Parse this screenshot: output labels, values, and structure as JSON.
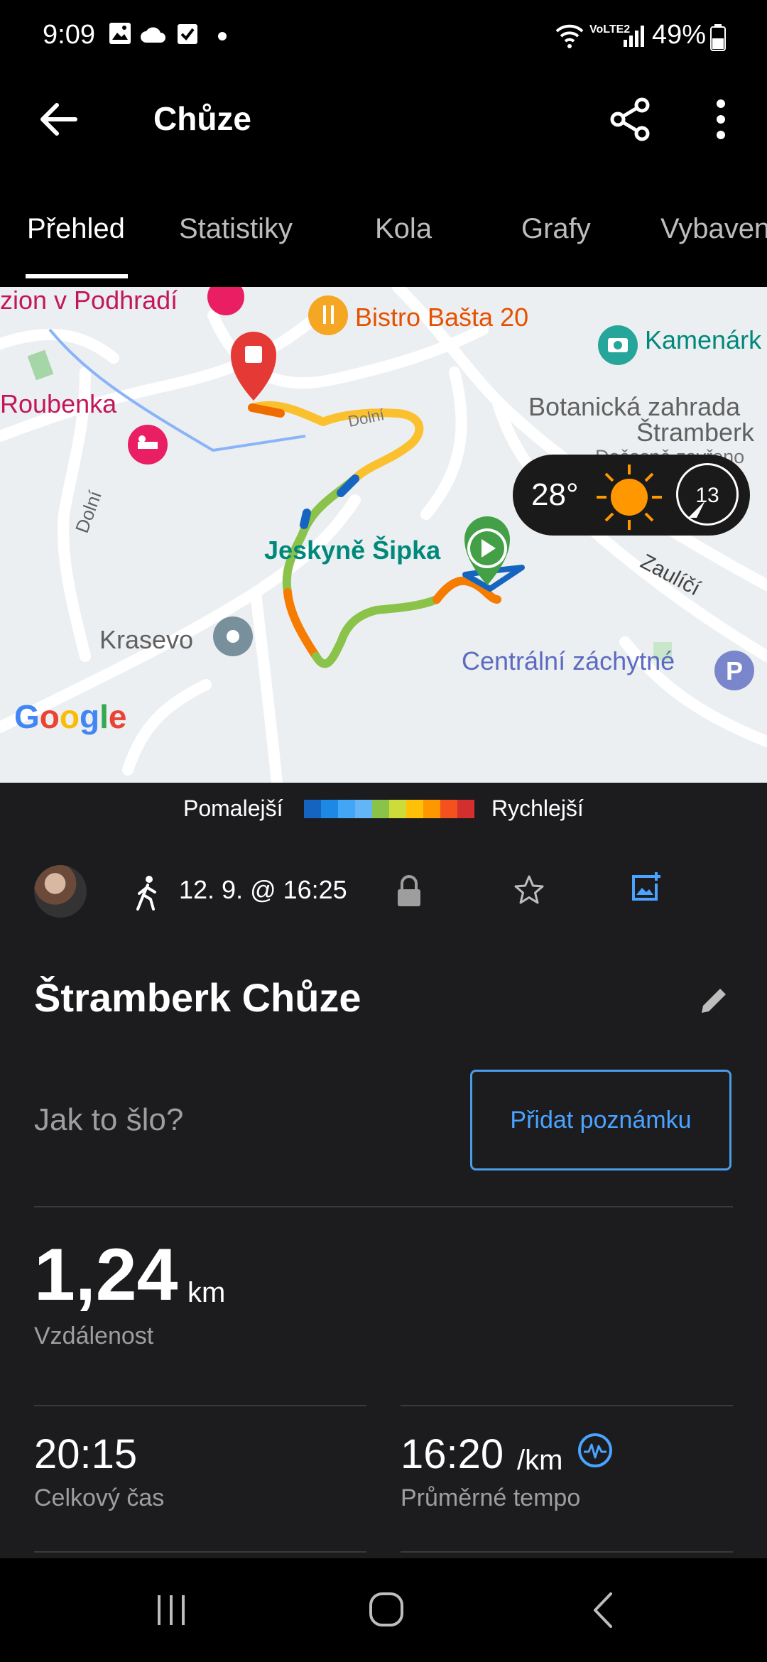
{
  "status_bar": {
    "time": "9:09",
    "battery": "49%",
    "network": "VoLTE2"
  },
  "app_bar": {
    "title": "Chůze",
    "back_icon": "arrow-left-icon",
    "share_icon": "share-icon",
    "more_icon": "more-vert-icon"
  },
  "tabs": [
    {
      "label": "Přehled",
      "active": true
    },
    {
      "label": "Statistiky",
      "active": false
    },
    {
      "label": "Kola",
      "active": false
    },
    {
      "label": "Grafy",
      "active": false
    },
    {
      "label": "Vybaven",
      "active": false
    }
  ],
  "map": {
    "labels": {
      "penzion": "zion v Podhradí",
      "bistro": "Bistro Bašta 20",
      "kamenarka": "Kamenárk",
      "roubenka": "Roubenka",
      "botanicka1": "Botanická zahrada",
      "botanicka2": "Štramberk",
      "docasne": "Dočasně zavřeno",
      "jeskyne": "Jeskyně Šipka",
      "dolni1": "Dolní",
      "dolni2": "Dolní",
      "zaulici": "Zaulíčí",
      "krasevo": "Krasevo",
      "centralni": "Centrální záchytné"
    },
    "google": "Google",
    "weather": {
      "temp": "28°",
      "wind": "13"
    }
  },
  "speed_legend": {
    "slower": "Pomalejší",
    "faster": "Rychlejší",
    "colors": [
      "#1565c0",
      "#1e88e5",
      "#42a5f5",
      "#64b5f6",
      "#8bc34a",
      "#cddc39",
      "#ffc107",
      "#ff9800",
      "#f4511e",
      "#d32f2f"
    ]
  },
  "activity": {
    "date": "12. 9. @ 16:25",
    "name": "Štramberk Chůze",
    "note_prompt": "Jak to šlo?",
    "note_button": "Přidat poznámku",
    "distance_value": "1,24",
    "distance_unit": "km",
    "distance_label": "Vzdálenost",
    "total_time_value": "20:15",
    "total_time_label": "Celkový čas",
    "avg_pace_value": "16:20",
    "avg_pace_unit": "/km",
    "avg_pace_label": "Průměrné tempo"
  },
  "accent": "#4aa3ff"
}
